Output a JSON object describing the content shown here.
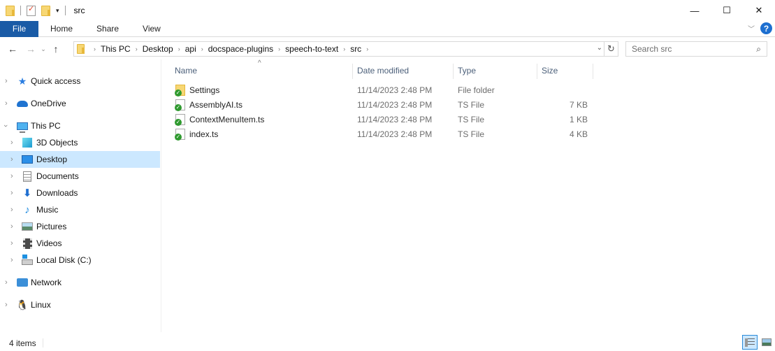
{
  "window": {
    "title": "src",
    "controls": {
      "minimize": "—",
      "maximize": "☐",
      "close": "✕"
    }
  },
  "ribbon": {
    "tabs": [
      {
        "label": "File",
        "active": true
      },
      {
        "label": "Home"
      },
      {
        "label": "Share"
      },
      {
        "label": "View"
      }
    ],
    "expand_icon": "chevron-down-icon",
    "help_label": "?"
  },
  "navigation": {
    "back": "←",
    "forward": "→",
    "recent": "⌄",
    "up": "↑",
    "breadcrumb": [
      "This PC",
      "Desktop",
      "api",
      "docspace-plugins",
      "speech-to-text",
      "src"
    ],
    "refresh": "↻",
    "search_placeholder": "Search src",
    "search_value": ""
  },
  "sidebar": {
    "items": [
      {
        "label": "Quick access",
        "icon": "star-icon",
        "level": 0,
        "expanded": false
      },
      {
        "label": "OneDrive",
        "icon": "cloud-icon",
        "level": 0,
        "expanded": false
      },
      {
        "label": "This PC",
        "icon": "computer-icon",
        "level": 0,
        "expanded": true
      },
      {
        "label": "3D Objects",
        "icon": "cube-icon",
        "level": 1,
        "expanded": false
      },
      {
        "label": "Desktop",
        "icon": "desktop-icon",
        "level": 1,
        "expanded": false,
        "selected": true
      },
      {
        "label": "Documents",
        "icon": "documents-icon",
        "level": 1,
        "expanded": false
      },
      {
        "label": "Downloads",
        "icon": "download-icon",
        "level": 1,
        "expanded": false
      },
      {
        "label": "Music",
        "icon": "music-icon",
        "level": 1,
        "expanded": false
      },
      {
        "label": "Pictures",
        "icon": "pictures-icon",
        "level": 1,
        "expanded": false
      },
      {
        "label": "Videos",
        "icon": "videos-icon",
        "level": 1,
        "expanded": false
      },
      {
        "label": "Local Disk (C:)",
        "icon": "disk-icon",
        "level": 1,
        "expanded": false
      },
      {
        "label": "Network",
        "icon": "network-icon",
        "level": 0,
        "expanded": false
      },
      {
        "label": "Linux",
        "icon": "linux-icon",
        "level": 0,
        "expanded": false
      }
    ]
  },
  "file_list": {
    "columns": [
      "Name",
      "Date modified",
      "Type",
      "Size"
    ],
    "sort_indicator": "^",
    "rows": [
      {
        "name": "Settings",
        "date": "11/14/2023 2:48 PM",
        "type": "File folder",
        "size": "",
        "kind": "folder"
      },
      {
        "name": "AssemblyAI.ts",
        "date": "11/14/2023 2:48 PM",
        "type": "TS File",
        "size": "7 KB",
        "kind": "file"
      },
      {
        "name": "ContextMenuItem.ts",
        "date": "11/14/2023 2:48 PM",
        "type": "TS File",
        "size": "1 KB",
        "kind": "file"
      },
      {
        "name": "index.ts",
        "date": "11/14/2023 2:48 PM",
        "type": "TS File",
        "size": "4 KB",
        "kind": "file"
      }
    ]
  },
  "status_bar": {
    "item_count": "4 items",
    "view_modes": [
      "details",
      "large-icons"
    ],
    "active_view": "details"
  },
  "colors": {
    "file_tab": "#1a5ba6",
    "selection": "#cce8ff",
    "header_text": "#4c607a",
    "sync_ok": "#2f9a2f"
  }
}
